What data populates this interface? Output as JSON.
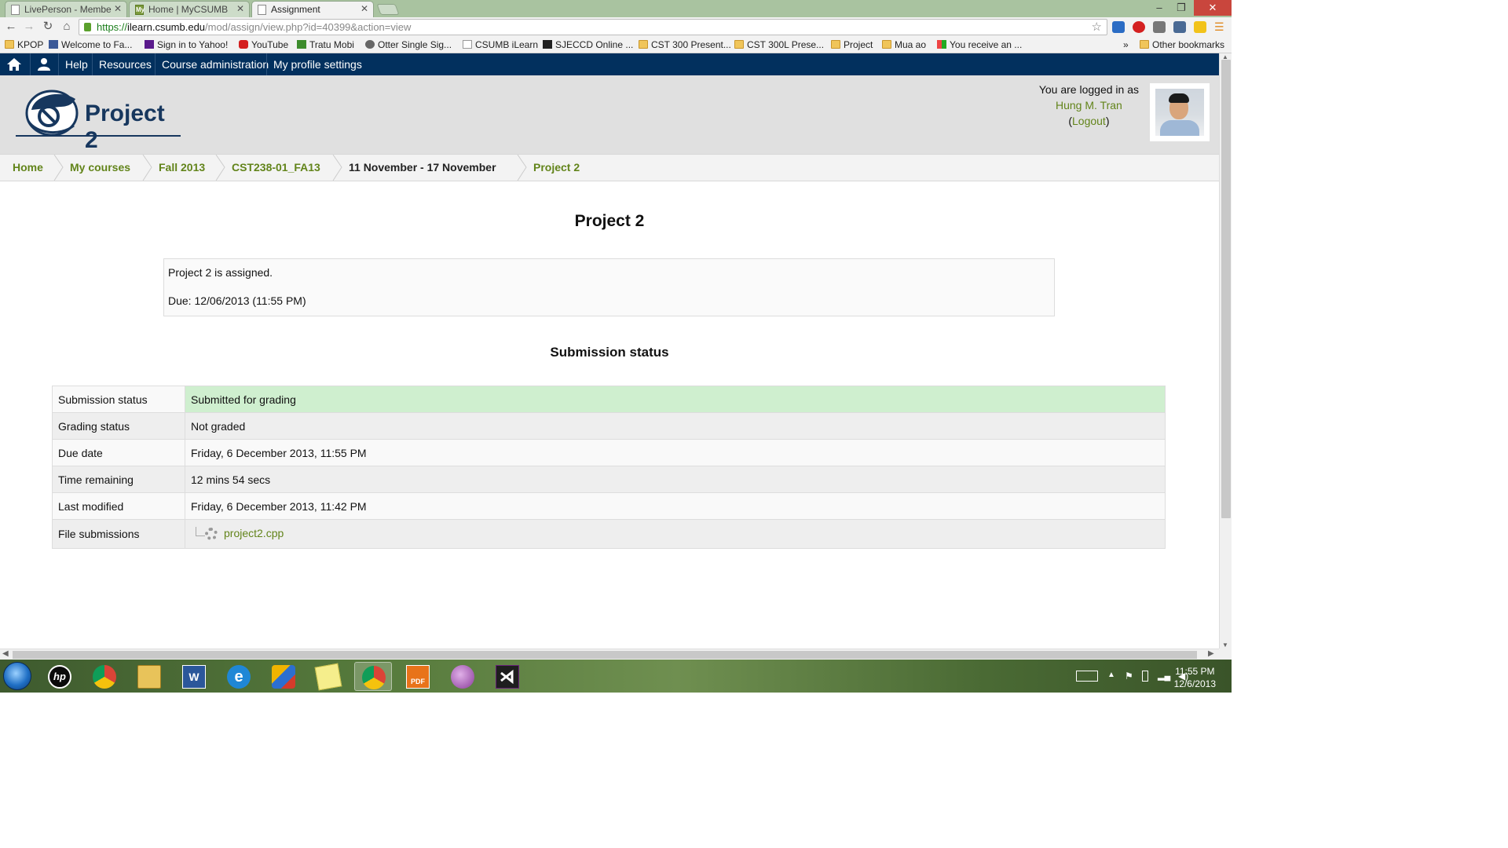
{
  "browser": {
    "tabs": [
      {
        "label": "LivePerson - Membe",
        "active": false
      },
      {
        "label": "Home | MyCSUMB",
        "active": false
      },
      {
        "label": "Assignment",
        "active": true
      }
    ],
    "url": {
      "scheme": "https://",
      "host": "ilearn.csumb.edu",
      "path": "/mod/assign/view.php?id=40399&action=view"
    },
    "bookmarks": [
      {
        "label": "KPOP",
        "icon": "folder-icon"
      },
      {
        "label": "Welcome to Fa...",
        "icon": "facebook-icon"
      },
      {
        "label": "Sign in to Yahoo!",
        "icon": "yahoo-icon"
      },
      {
        "label": "YouTube",
        "icon": "youtube-icon"
      },
      {
        "label": "Tratu Mobi",
        "icon": "tratu-icon"
      },
      {
        "label": "Otter Single Sig...",
        "icon": "otter-icon"
      },
      {
        "label": "CSUMB iLearn",
        "icon": "page-icon"
      },
      {
        "label": "SJECCD Online ...",
        "icon": "sjeccd-icon"
      },
      {
        "label": "CST 300 Present...",
        "icon": "folder-icon"
      },
      {
        "label": "CST 300L Prese...",
        "icon": "folder-icon"
      },
      {
        "label": "Project",
        "icon": "folder-icon"
      },
      {
        "label": "Mua ao",
        "icon": "folder-icon"
      },
      {
        "label": "You receive an ...",
        "icon": "windows-icon"
      }
    ],
    "overflow": "»",
    "other_bookmarks": "Other bookmarks"
  },
  "navbar": {
    "items": [
      "Help",
      "Resources",
      "Course administration",
      "My profile settings"
    ]
  },
  "header": {
    "site_title": "Project 2",
    "login_prefix": "You are logged in as",
    "user_name": "Hung M. Tran",
    "logout_open": "(",
    "logout_label": "Logout",
    "logout_close": ")"
  },
  "breadcrumb": [
    {
      "label": "Home",
      "link": true
    },
    {
      "label": "My courses",
      "link": true
    },
    {
      "label": "Fall 2013",
      "link": true
    },
    {
      "label": "CST238-01_FA13",
      "link": true
    },
    {
      "label": "11 November - 17 November",
      "link": false
    },
    {
      "label": "Project 2",
      "link": true
    }
  ],
  "main": {
    "title": "Project 2",
    "intro_line1": "Project 2 is assigned.",
    "intro_line2": "Due: 12/06/2013 (11:55 PM)",
    "submission_heading": "Submission status",
    "rows": [
      {
        "label": "Submission status",
        "value": "Submitted for grading"
      },
      {
        "label": "Grading status",
        "value": "Not graded"
      },
      {
        "label": "Due date",
        "value": "Friday, 6 December 2013, 11:55 PM"
      },
      {
        "label": "Time remaining",
        "value": "12 mins 54 secs"
      },
      {
        "label": "Last modified",
        "value": "Friday, 6 December 2013, 11:42 PM"
      },
      {
        "label": "File submissions",
        "value": "project2.cpp"
      }
    ]
  },
  "taskbar": {
    "apps": [
      "hp-icon",
      "chrome-icon",
      "file-explorer-icon",
      "word-icon",
      "ie-icon",
      "paint-icon",
      "sticky-notes-icon",
      "chrome-icon",
      "pdf-icon",
      "messenger-icon",
      "visual-studio-icon"
    ],
    "time": "11:55 PM",
    "date": "12/6/2013"
  },
  "colors": {
    "navbar": "#02305e",
    "link_green": "#62841a",
    "submitted_bg": "#cfefcf"
  }
}
